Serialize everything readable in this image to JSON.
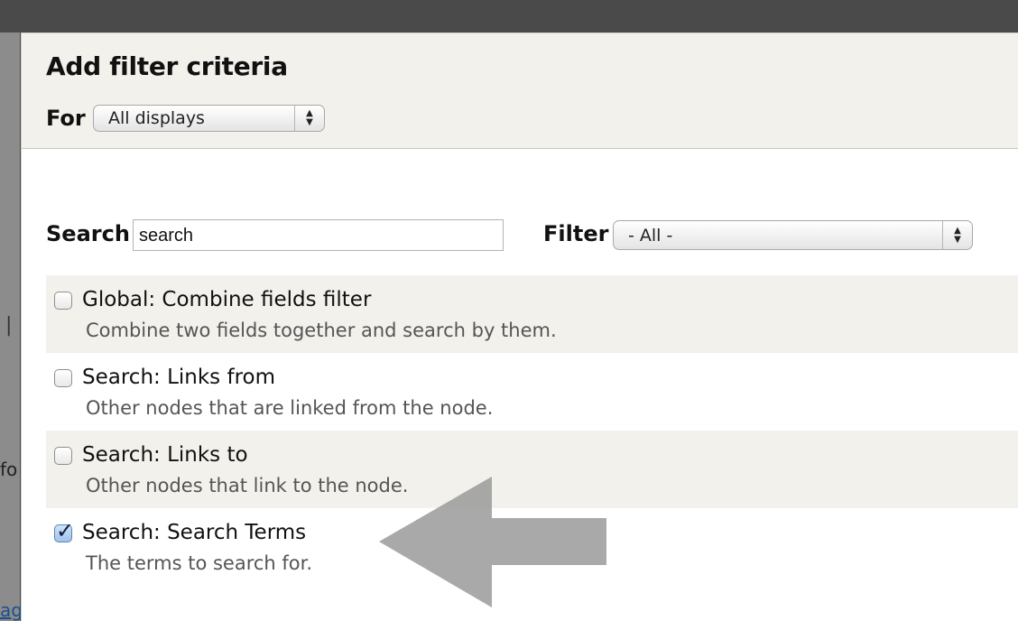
{
  "dialog": {
    "title": "Add filter criteria",
    "for_label": "For",
    "for_select_value": "All displays"
  },
  "toolbar": {
    "search_label": "Search",
    "search_value": "search",
    "filter_label": "Filter",
    "filter_select_value": "- All -"
  },
  "options": [
    {
      "title": "Global: Combine fields filter",
      "description": "Combine two fields together and search by them.",
      "checked": false
    },
    {
      "title": "Search: Links from",
      "description": "Other nodes that are linked from the node.",
      "checked": false
    },
    {
      "title": "Search: Links to",
      "description": "Other nodes that link to the node.",
      "checked": false
    },
    {
      "title": "Search: Search Terms",
      "description": "The terms to search for.",
      "checked": true
    }
  ],
  "background": {
    "fragment_fo": "fo",
    "fragment_ag": "ag",
    "fragment_pipe": "|"
  },
  "colors": {
    "header_bg": "#f2f1ec",
    "row_shade": "#f2f1ec",
    "arrow": "#9a9a9a",
    "checkbox_checked": "#9fc3ea"
  },
  "icons": {
    "select_arrow": "up-down-chevron-icon",
    "checkbox_check": "check-icon",
    "annotation": "left-arrow-icon"
  }
}
